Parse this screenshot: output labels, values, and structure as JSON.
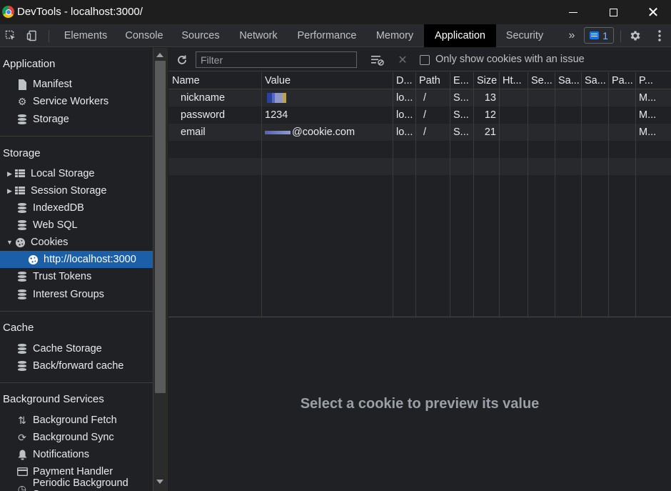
{
  "window": {
    "title": "DevTools - localhost:3000/"
  },
  "tabs": [
    {
      "label": "Elements"
    },
    {
      "label": "Console"
    },
    {
      "label": "Sources"
    },
    {
      "label": "Network"
    },
    {
      "label": "Performance"
    },
    {
      "label": "Memory"
    },
    {
      "label": "Application",
      "active": true
    },
    {
      "label": "Security"
    }
  ],
  "issues": {
    "count": "1"
  },
  "sidebar": {
    "sections": {
      "application": "Application",
      "storage": "Storage",
      "cache": "Cache",
      "background": "Background Services"
    },
    "application_items": [
      "Manifest",
      "Service Workers",
      "Storage"
    ],
    "storage_items": [
      "Local Storage",
      "Session Storage",
      "IndexedDB",
      "Web SQL",
      "Cookies",
      "http://localhost:3000",
      "Trust Tokens",
      "Interest Groups"
    ],
    "cache_items": [
      "Cache Storage",
      "Back/forward cache"
    ],
    "background_items": [
      "Background Fetch",
      "Background Sync",
      "Notifications",
      "Payment Handler",
      "Periodic Background Sync"
    ]
  },
  "toolbar": {
    "filter_placeholder": "Filter",
    "only_issues_label": "Only show cookies with an issue"
  },
  "cookies": {
    "columns": [
      "Name",
      "Value",
      "D...",
      "Path",
      "E...",
      "Size",
      "Ht...",
      "Se...",
      "Sa...",
      "Sa...",
      "Pa...",
      "P..."
    ],
    "rows": [
      {
        "name": "nickname",
        "value": "",
        "domain": "lo...",
        "path": "/",
        "expires": "S...",
        "size": "13",
        "priority": "M..."
      },
      {
        "name": "password",
        "value": "1234",
        "domain": "lo...",
        "path": "/",
        "expires": "S...",
        "size": "12",
        "priority": "M..."
      },
      {
        "name": "email",
        "value": "@cookie.com",
        "domain": "lo...",
        "path": "/",
        "expires": "S...",
        "size": "21",
        "priority": "M..."
      }
    ]
  },
  "preview": {
    "message": "Select a cookie to preview its value"
  },
  "colors": {
    "accent": "#1a5fa8",
    "background": "#202124",
    "tab_active": "#000000"
  }
}
